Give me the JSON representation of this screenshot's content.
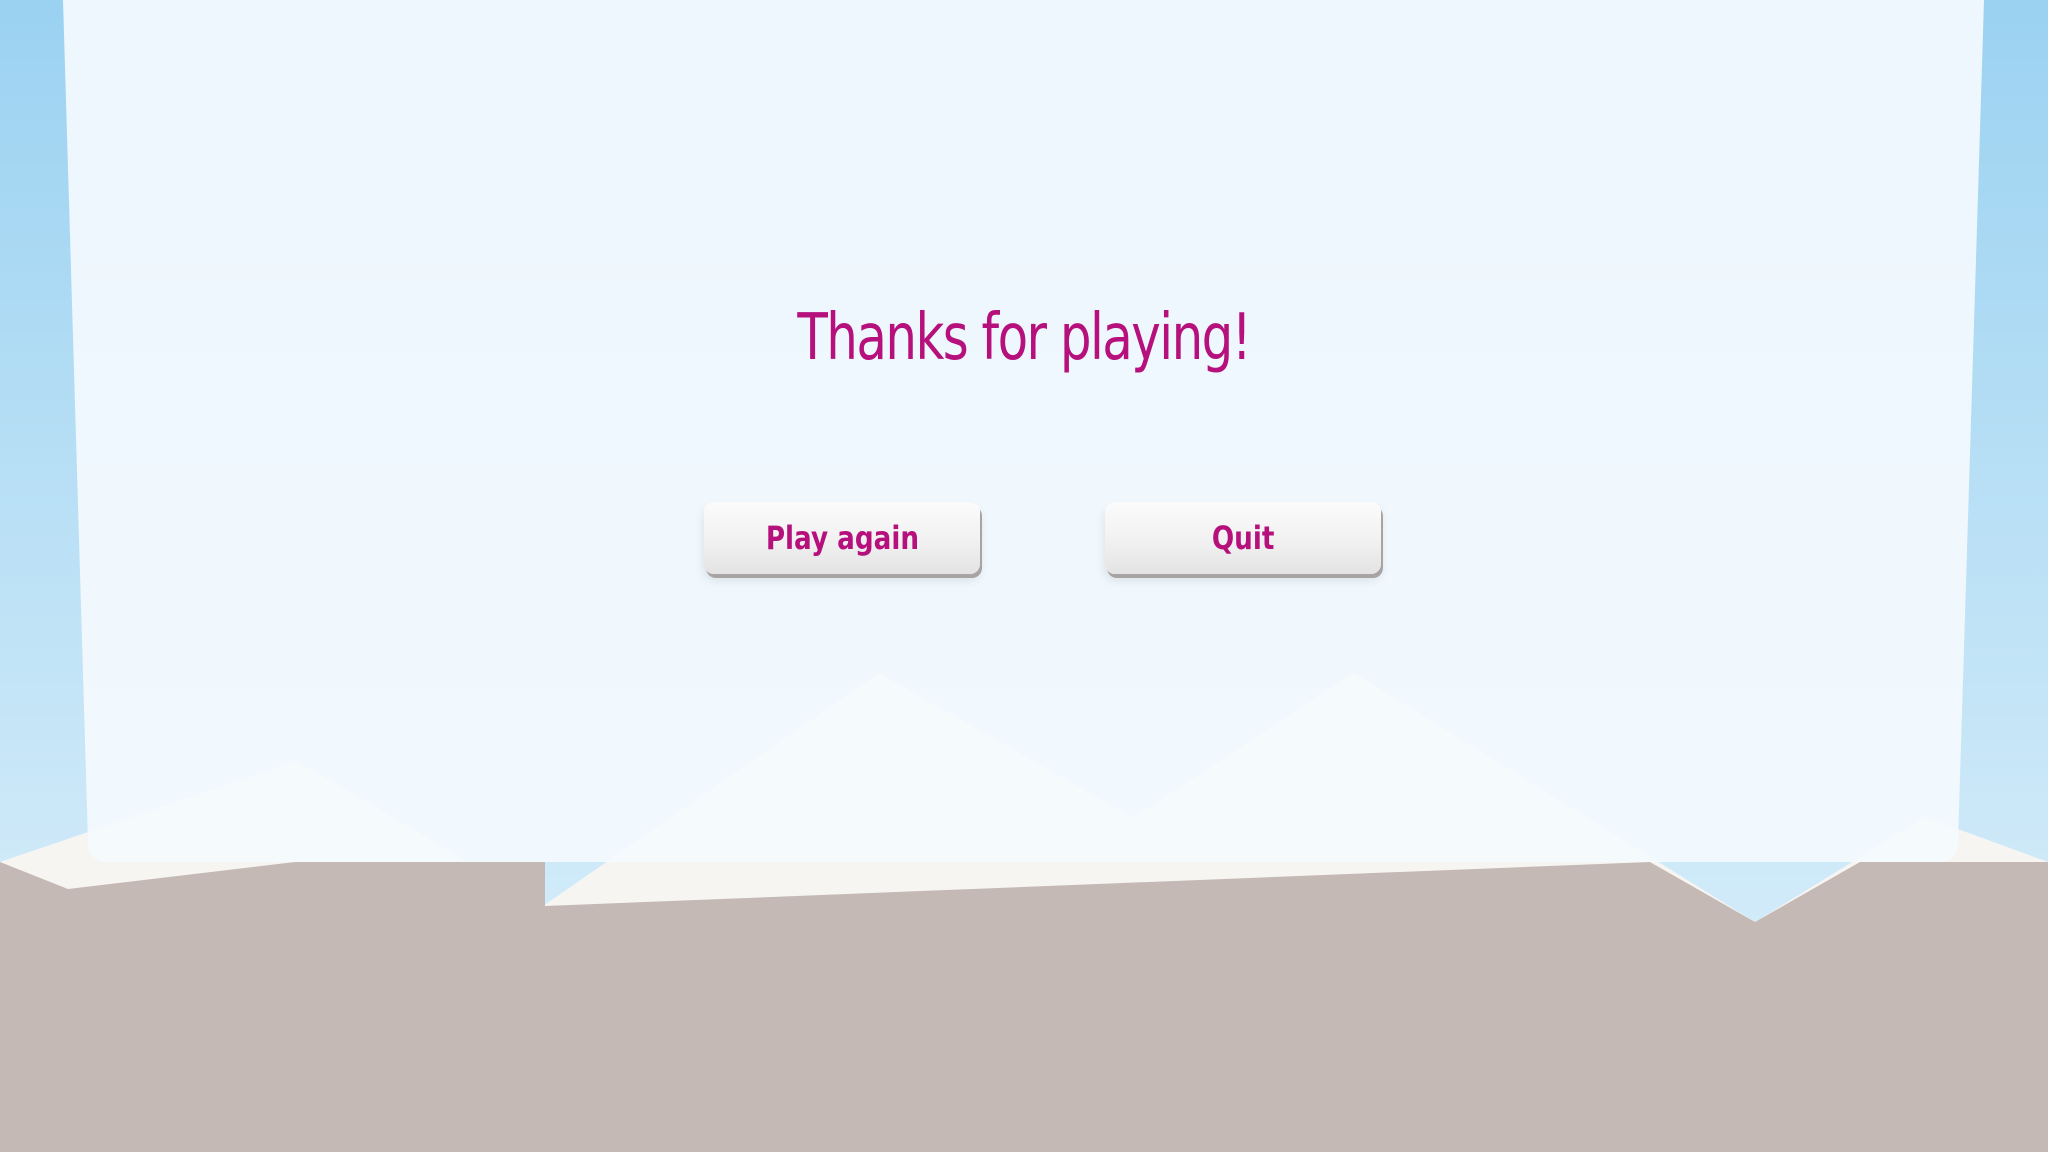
{
  "screen": {
    "title": "Thanks for playing!"
  },
  "buttons": {
    "play_again_label": "Play again",
    "quit_label": "Quit"
  },
  "colors": {
    "sky_top": "#9dd3f1",
    "sky_bottom": "#d7eefa",
    "ground": "#c4b9b5",
    "snow": "#f7f5f2",
    "panel": "#f4fafe",
    "accent_text": "#b5107c",
    "button_face": "#f1f1f1",
    "button_shadow": "#a8a4a4"
  }
}
